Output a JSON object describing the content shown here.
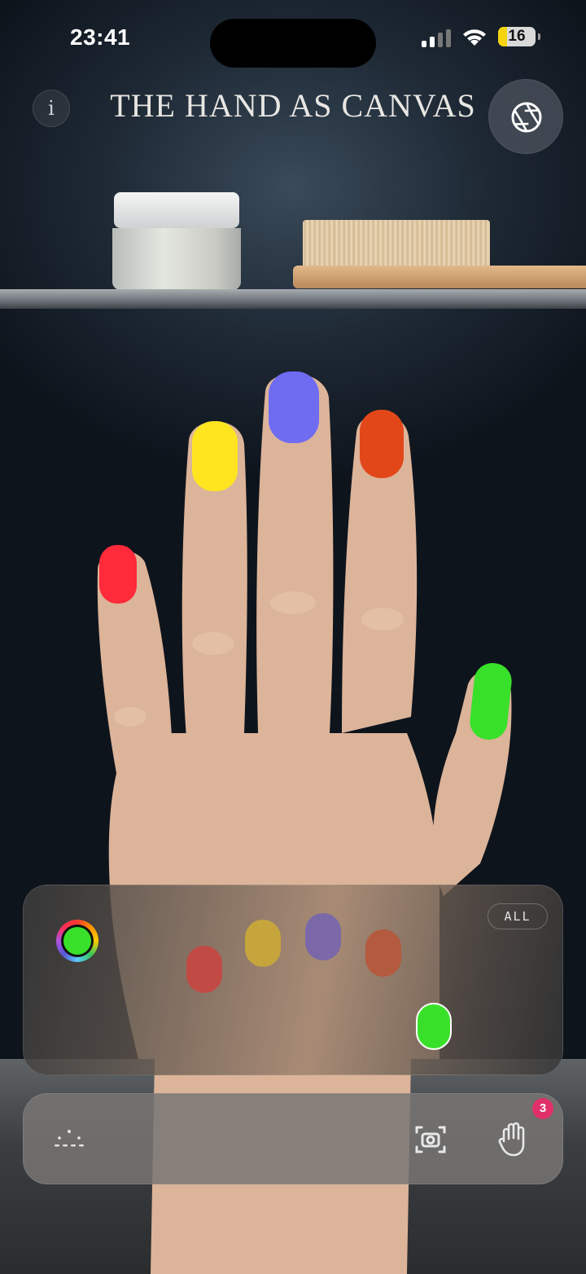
{
  "status_bar": {
    "time": "23:41",
    "battery_level": "16",
    "battery_color": "#f5d40f"
  },
  "header": {
    "title": "THE HAND AS CANVAS",
    "info_icon_glyph": "i",
    "info_icon": "info-icon",
    "capture_icon": "aperture-icon"
  },
  "nails": {
    "thumb": {
      "color": "#39e02a"
    },
    "index": {
      "color": "#ffe51f"
    },
    "middle": {
      "color": "#6f6cf2"
    },
    "ring": {
      "color": "#e2471a"
    },
    "pinky": {
      "color": "#ff2a3a"
    }
  },
  "palette": {
    "current_color": "#39e02a",
    "all_label": "ALL",
    "swatches": [
      {
        "finger": "pinky",
        "color": "#c24a45"
      },
      {
        "finger": "index",
        "color": "#c5a53c"
      },
      {
        "finger": "middle",
        "color": "#7a68a8"
      },
      {
        "finger": "ring",
        "color": "#b45a3e"
      },
      {
        "finger": "thumb",
        "color": "#39e02a",
        "selected": true
      }
    ]
  },
  "toolbar": {
    "left_icon": "sparkle-dots-icon",
    "camera_icon": "camera-scan-icon",
    "hand_icon": "hand-icon",
    "badge_count": "3"
  }
}
